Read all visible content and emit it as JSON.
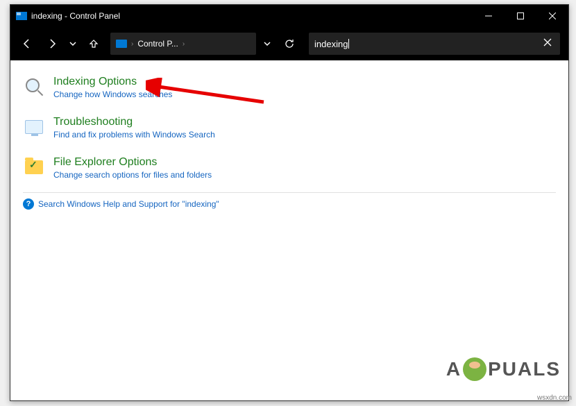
{
  "window": {
    "title": "indexing - Control Panel"
  },
  "breadcrumb": {
    "label": "Control P..."
  },
  "search": {
    "value": "indexing"
  },
  "results": [
    {
      "title": "Indexing Options",
      "desc": "Change how Windows searches",
      "icon": "search-glass"
    },
    {
      "title": "Troubleshooting",
      "desc": "Find and fix problems with Windows Search",
      "icon": "monitor-icon"
    },
    {
      "title": "File Explorer Options",
      "desc": "Change search options for files and folders",
      "icon": "folder-icon folder-check"
    }
  ],
  "help_link": "Search Windows Help and Support for \"indexing\"",
  "watermark": {
    "prefix": "A",
    "suffix": "PUALS"
  },
  "source": "wsxdn.com"
}
